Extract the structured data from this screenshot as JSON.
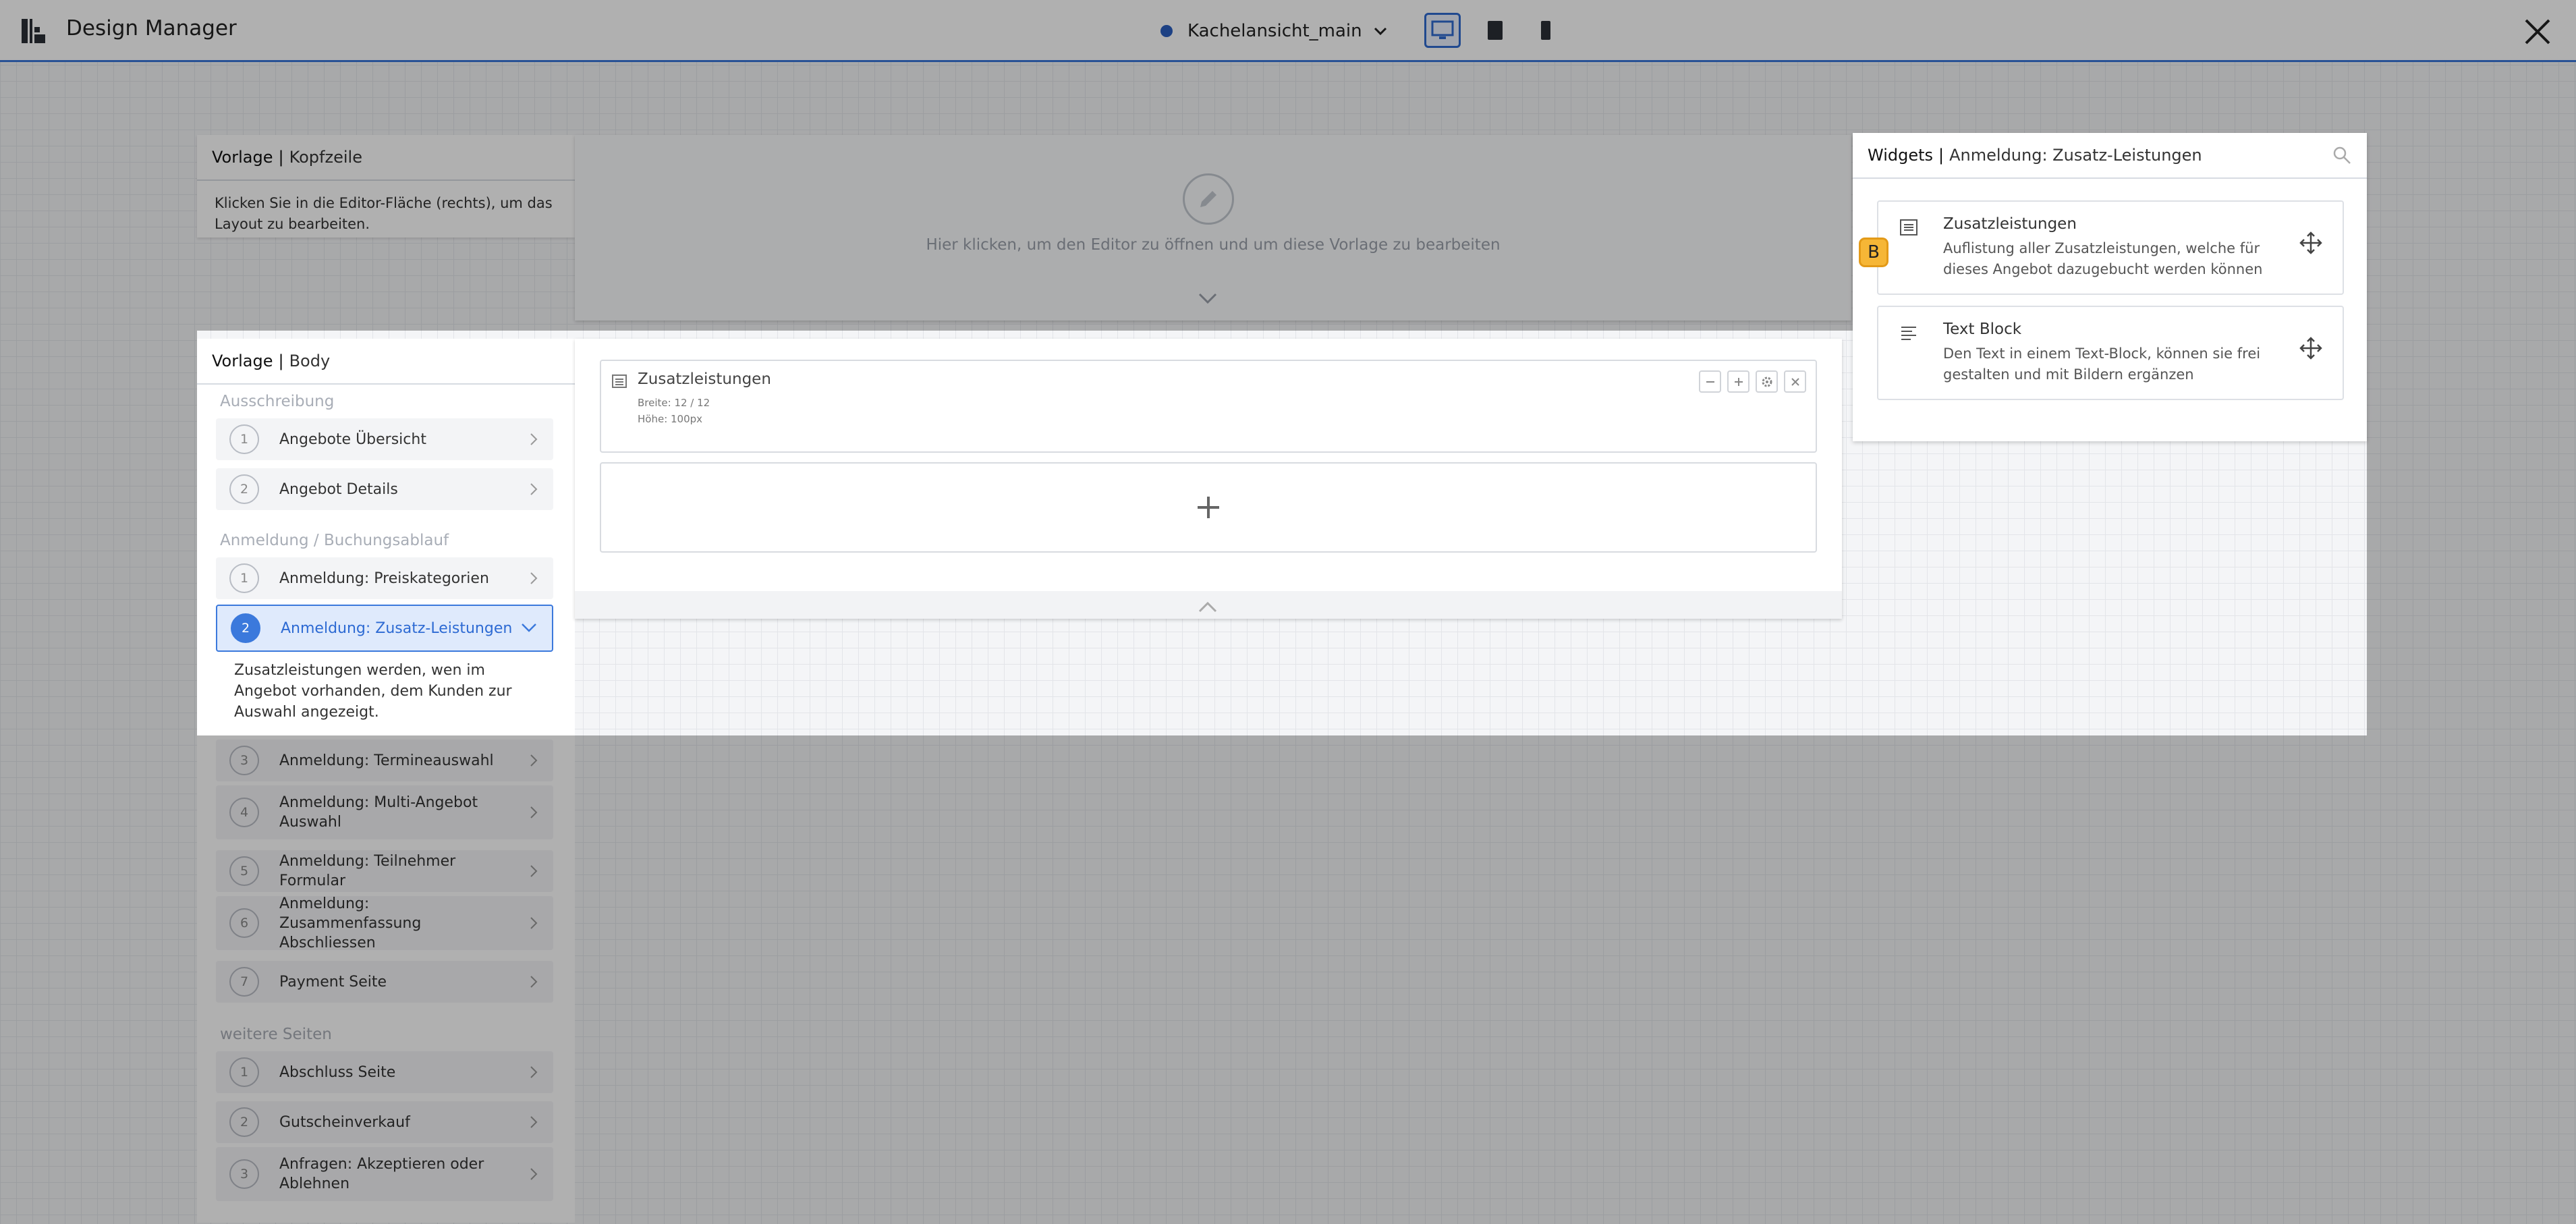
{
  "header": {
    "title": "Design Manager",
    "view_name": "Kachelansicht_main"
  },
  "colors": {
    "accent": "#3b79dc",
    "badge": "#f6b636"
  },
  "kopfzeile": {
    "title_bold": "Vorlage",
    "title_rest": "Kopfzeile",
    "hint": "Klicken Sie in die Editor-Fläche (rechts), um das Layout zu bearbeiten.",
    "editor_hint": "Hier klicken, um den Editor zu öffnen und um diese Vorlage zu bearbeiten"
  },
  "body": {
    "title_bold": "Vorlage",
    "title_rest": "Body",
    "sections": [
      {
        "label": "Ausschreibung"
      },
      {
        "label": "Anmeldung / Buchungsablauf"
      },
      {
        "label": "weitere Seiten"
      }
    ],
    "steps": [
      {
        "num": "1",
        "label": "Angebote Übersicht"
      },
      {
        "num": "2",
        "label": "Angebot Details"
      },
      {
        "num": "1",
        "label": "Anmeldung: Preiskategorien"
      },
      {
        "num": "2",
        "label": "Anmeldung: Zusatz-Leistungen"
      },
      {
        "num": "3",
        "label": "Anmeldung: Termineauswahl"
      },
      {
        "num": "4",
        "label": "Anmeldung: Multi-Angebot Auswahl"
      },
      {
        "num": "5",
        "label": "Anmeldung: Teilnehmer Formular"
      },
      {
        "num": "6",
        "label": "Anmeldung: Zusammenfassung Abschliessen"
      },
      {
        "num": "7",
        "label": "Payment Seite"
      },
      {
        "num": "1",
        "label": "Abschluss Seite"
      },
      {
        "num": "2",
        "label": "Gutscheinverkauf"
      },
      {
        "num": "3",
        "label": "Anfragen: Akzeptieren oder Ablehnen"
      }
    ],
    "active_description": "Zusatzleistungen werden, wen im Angebot vorhanden, dem Kunden zur Auswahl angezeigt.",
    "widget": {
      "title": "Zusatzleistungen",
      "width": "Breite: 12 / 12",
      "height": "Höhe: 100px"
    }
  },
  "widgets_panel": {
    "title_bold": "Widgets",
    "title_rest": "Anmeldung: Zusatz-Leistungen",
    "badge": "B",
    "items": [
      {
        "title": "Zusatzleistungen",
        "desc": "Auflistung aller Zusatzleistungen, welche für dieses Angebot dazugebucht werden können",
        "icon": "list-icon"
      },
      {
        "title": "Text Block",
        "desc": "Den Text in einem Text-Block, können sie frei gestalten und mit Bildern ergänzen",
        "icon": "text-lines-icon"
      }
    ]
  }
}
